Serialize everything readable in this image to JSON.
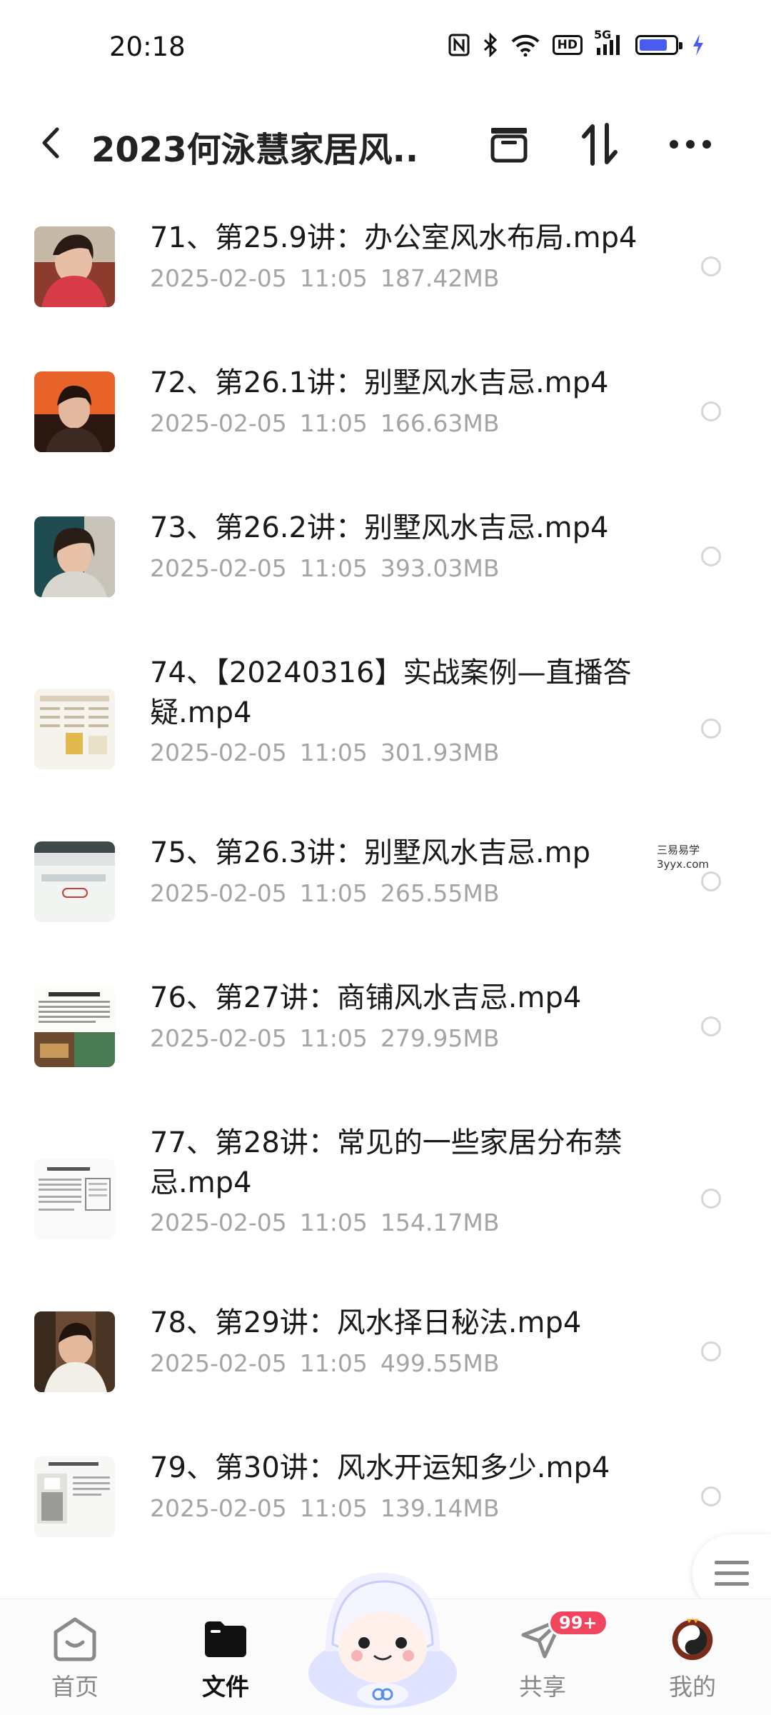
{
  "status": {
    "time": "20:18",
    "net": "5G",
    "hd": "HD",
    "battery_level": 0.82,
    "battery_color": "#4a5cf0",
    "icons": [
      "nfc-icon",
      "bluetooth-icon",
      "wifi-icon",
      "hd-icon",
      "signal-icon",
      "battery-icon",
      "charging-icon"
    ]
  },
  "header": {
    "title": "2023何泳慧家居风...",
    "icons": [
      "back-icon",
      "archive-icon",
      "sort-icon",
      "more-icon"
    ]
  },
  "files": [
    {
      "name": "71、第25.9讲：办公室风水布局.mp4",
      "date": "2025-02-05",
      "time": "11:05",
      "size": "187.42MB",
      "thumb": "portrait"
    },
    {
      "name": "72、第26.1讲：别墅风水吉忌.mp4",
      "date": "2025-02-05",
      "time": "11:05",
      "size": "166.63MB",
      "thumb": "portrait-orange"
    },
    {
      "name": "73、第26.2讲：别墅风水吉忌.mp4",
      "date": "2025-02-05",
      "time": "11:05",
      "size": "393.03MB",
      "thumb": "portrait-dark"
    },
    {
      "name": "74、【20240316】实战案例—直播答疑.mp4",
      "date": "2025-02-05",
      "time": "11:05",
      "size": "301.93MB",
      "thumb": "chart"
    },
    {
      "name": "75、第26.3讲：别墅风水吉忌.mp",
      "date": "2025-02-05",
      "time": "11:05",
      "size": "265.55MB",
      "thumb": "slide"
    },
    {
      "name": "76、第27讲：商铺风水吉忌.mp4",
      "date": "2025-02-05",
      "time": "11:05",
      "size": "279.95MB",
      "thumb": "doc-photo"
    },
    {
      "name": "77、第28讲：常见的一些家居分布禁忌.mp4",
      "date": "2025-02-05",
      "time": "11:05",
      "size": "154.17MB",
      "thumb": "doc"
    },
    {
      "name": "78、第29讲：风水择日秘法.mp4",
      "date": "2025-02-05",
      "time": "11:05",
      "size": "499.55MB",
      "thumb": "portrait-room"
    },
    {
      "name": "79、第30讲：风水开运知多少.mp4",
      "date": "2025-02-05",
      "time": "11:05",
      "size": "139.14MB",
      "thumb": "doc-room"
    }
  ],
  "watermark": {
    "line1": "三易易学",
    "line2": "3yyx.com"
  },
  "nav": {
    "home": "首页",
    "files": "文件",
    "share": "共享",
    "share_badge": "99+",
    "me": "我的",
    "active": "files"
  },
  "colors": {
    "accent": "#4a5cf0",
    "badge": "#f2455e",
    "meta": "#a4a4a4"
  }
}
